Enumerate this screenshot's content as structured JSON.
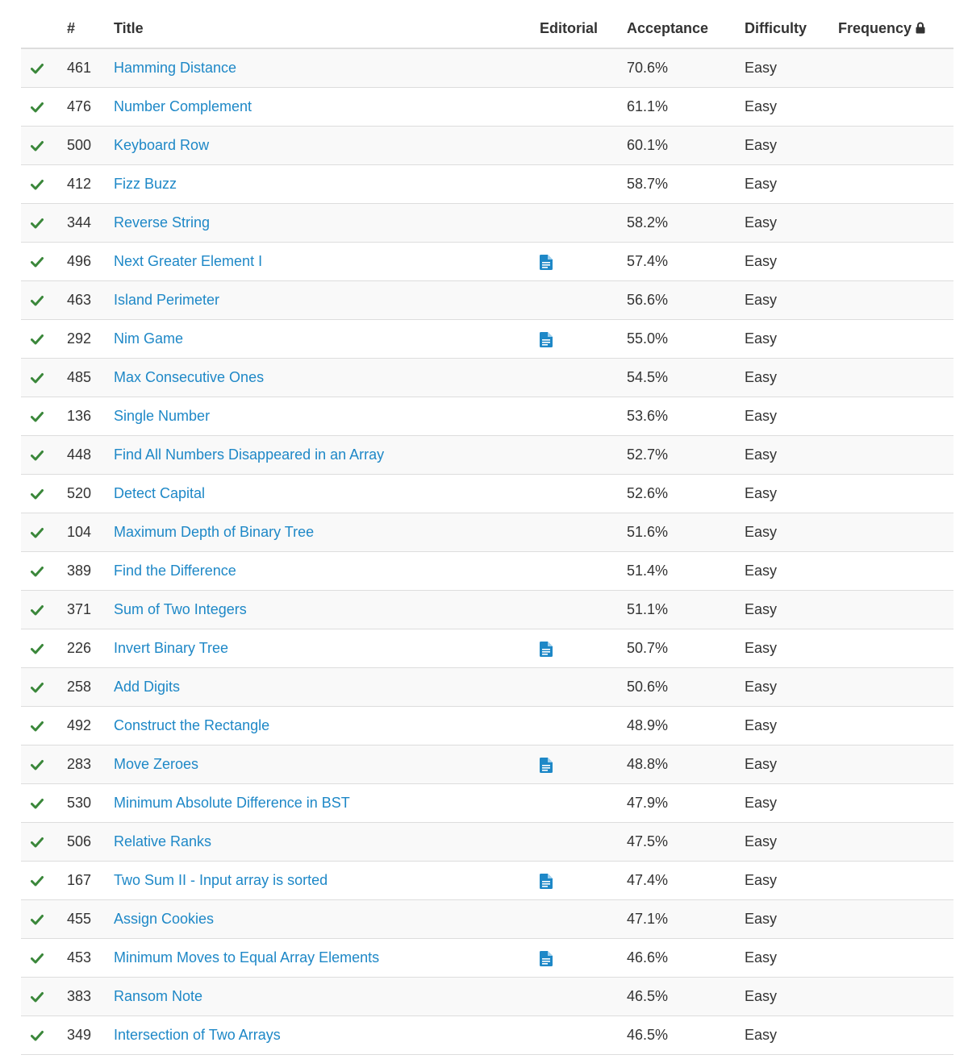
{
  "columns": {
    "id": "#",
    "title": "Title",
    "editorial": "Editorial",
    "acceptance": "Acceptance",
    "difficulty": "Difficulty",
    "frequency": "Frequency"
  },
  "colors": {
    "link": "#1e88c7",
    "check": "#3a873a",
    "editorial_icon": "#1e88c7"
  },
  "icons": {
    "status": "check-icon",
    "editorial": "document-icon",
    "frequency_locked": "lock-icon"
  },
  "problems": [
    {
      "id": "461",
      "title": "Hamming Distance",
      "editorial": false,
      "acceptance": "70.6%",
      "difficulty": "Easy"
    },
    {
      "id": "476",
      "title": "Number Complement",
      "editorial": false,
      "acceptance": "61.1%",
      "difficulty": "Easy"
    },
    {
      "id": "500",
      "title": "Keyboard Row",
      "editorial": false,
      "acceptance": "60.1%",
      "difficulty": "Easy"
    },
    {
      "id": "412",
      "title": "Fizz Buzz",
      "editorial": false,
      "acceptance": "58.7%",
      "difficulty": "Easy"
    },
    {
      "id": "344",
      "title": "Reverse String",
      "editorial": false,
      "acceptance": "58.2%",
      "difficulty": "Easy"
    },
    {
      "id": "496",
      "title": "Next Greater Element I",
      "editorial": true,
      "acceptance": "57.4%",
      "difficulty": "Easy"
    },
    {
      "id": "463",
      "title": "Island Perimeter",
      "editorial": false,
      "acceptance": "56.6%",
      "difficulty": "Easy"
    },
    {
      "id": "292",
      "title": "Nim Game",
      "editorial": true,
      "acceptance": "55.0%",
      "difficulty": "Easy"
    },
    {
      "id": "485",
      "title": "Max Consecutive Ones",
      "editorial": false,
      "acceptance": "54.5%",
      "difficulty": "Easy"
    },
    {
      "id": "136",
      "title": "Single Number",
      "editorial": false,
      "acceptance": "53.6%",
      "difficulty": "Easy"
    },
    {
      "id": "448",
      "title": "Find All Numbers Disappeared in an Array",
      "editorial": false,
      "acceptance": "52.7%",
      "difficulty": "Easy"
    },
    {
      "id": "520",
      "title": "Detect Capital",
      "editorial": false,
      "acceptance": "52.6%",
      "difficulty": "Easy"
    },
    {
      "id": "104",
      "title": "Maximum Depth of Binary Tree",
      "editorial": false,
      "acceptance": "51.6%",
      "difficulty": "Easy"
    },
    {
      "id": "389",
      "title": "Find the Difference",
      "editorial": false,
      "acceptance": "51.4%",
      "difficulty": "Easy"
    },
    {
      "id": "371",
      "title": "Sum of Two Integers",
      "editorial": false,
      "acceptance": "51.1%",
      "difficulty": "Easy"
    },
    {
      "id": "226",
      "title": "Invert Binary Tree",
      "editorial": true,
      "acceptance": "50.7%",
      "difficulty": "Easy"
    },
    {
      "id": "258",
      "title": "Add Digits",
      "editorial": false,
      "acceptance": "50.6%",
      "difficulty": "Easy"
    },
    {
      "id": "492",
      "title": "Construct the Rectangle",
      "editorial": false,
      "acceptance": "48.9%",
      "difficulty": "Easy"
    },
    {
      "id": "283",
      "title": "Move Zeroes",
      "editorial": true,
      "acceptance": "48.8%",
      "difficulty": "Easy"
    },
    {
      "id": "530",
      "title": "Minimum Absolute Difference in BST",
      "editorial": false,
      "acceptance": "47.9%",
      "difficulty": "Easy"
    },
    {
      "id": "506",
      "title": "Relative Ranks",
      "editorial": false,
      "acceptance": "47.5%",
      "difficulty": "Easy"
    },
    {
      "id": "167",
      "title": "Two Sum II - Input array is sorted",
      "editorial": true,
      "acceptance": "47.4%",
      "difficulty": "Easy"
    },
    {
      "id": "455",
      "title": "Assign Cookies",
      "editorial": false,
      "acceptance": "47.1%",
      "difficulty": "Easy"
    },
    {
      "id": "453",
      "title": "Minimum Moves to Equal Array Elements",
      "editorial": true,
      "acceptance": "46.6%",
      "difficulty": "Easy"
    },
    {
      "id": "383",
      "title": "Ransom Note",
      "editorial": false,
      "acceptance": "46.5%",
      "difficulty": "Easy"
    },
    {
      "id": "349",
      "title": "Intersection of Two Arrays",
      "editorial": false,
      "acceptance": "46.5%",
      "difficulty": "Easy"
    }
  ]
}
